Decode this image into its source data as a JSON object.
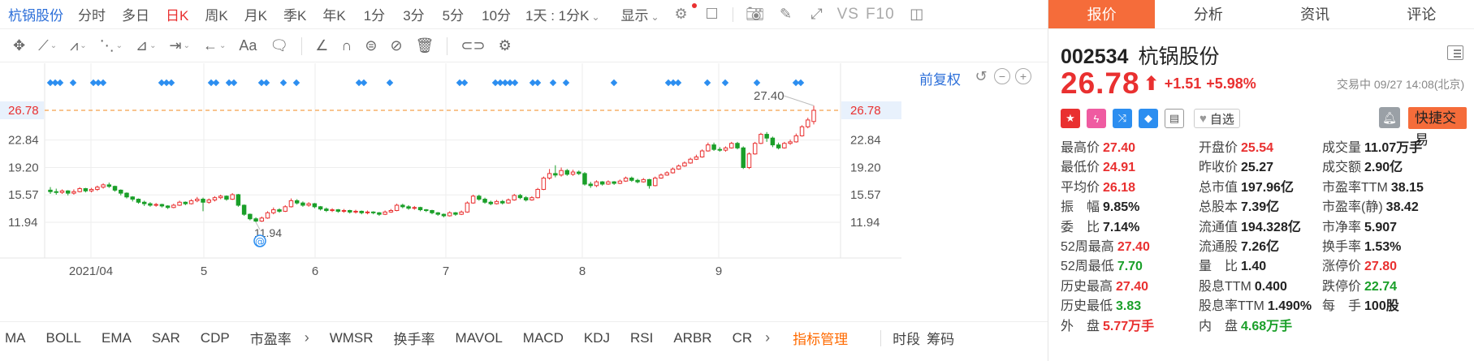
{
  "period_bar": {
    "stock_name": "杭锅股份",
    "periods": [
      "分时",
      "多日",
      "日K",
      "周K",
      "月K",
      "季K",
      "年K",
      "1分",
      "3分",
      "5分",
      "10分"
    ],
    "active": "日K",
    "interval_select": "1天 : 1分K",
    "display_label": "显示",
    "vs_label": "VS",
    "f10_label": "F10"
  },
  "toolbar_icons": [
    "move-icon",
    "line-icon",
    "polyline-icon",
    "wave-icon",
    "ruler-icon",
    "range-icon",
    "arrow-left-icon",
    "text-icon",
    "comment-icon",
    "angle-icon",
    "magnet-icon",
    "eye-lock-icon",
    "eye-off-icon",
    "trash-icon",
    "link-icon",
    "settings-icon"
  ],
  "chart_controls": {
    "adjust_label": "前复权"
  },
  "chart_data": {
    "type": "candlestick",
    "y_ticks": [
      "26.78",
      "22.84",
      "19.20",
      "15.57",
      "11.94"
    ],
    "y_tick_values": [
      26.78,
      22.84,
      19.2,
      15.57,
      11.94
    ],
    "x_ticks": [
      "2021/04",
      "5",
      "6",
      "7",
      "8",
      "9"
    ],
    "current_price": "26.78",
    "annotation_high": "27.40",
    "annotation_low": "11.94",
    "ylim": [
      8.5,
      32.0
    ],
    "candles": [
      [
        16.2,
        16.0,
        16.6,
        15.7
      ],
      [
        16.0,
        15.9,
        16.4,
        15.6
      ],
      [
        15.9,
        16.1,
        16.3,
        15.7
      ],
      [
        16.1,
        15.8,
        16.2,
        15.5
      ],
      [
        15.8,
        16.0,
        16.3,
        15.6
      ],
      [
        16.0,
        16.4,
        16.6,
        15.9
      ],
      [
        16.4,
        16.1,
        16.5,
        15.9
      ],
      [
        16.1,
        16.3,
        16.5,
        15.9
      ],
      [
        16.3,
        16.6,
        16.8,
        16.1
      ],
      [
        16.6,
        16.9,
        17.1,
        16.4
      ],
      [
        16.9,
        16.7,
        17.2,
        16.5
      ],
      [
        16.7,
        16.2,
        16.8,
        16.0
      ],
      [
        16.2,
        15.8,
        16.3,
        15.5
      ],
      [
        15.8,
        15.3,
        15.9,
        15.1
      ],
      [
        15.3,
        15.0,
        15.4,
        14.7
      ],
      [
        15.0,
        14.6,
        15.1,
        14.4
      ],
      [
        14.6,
        14.4,
        14.8,
        14.1
      ],
      [
        14.4,
        14.2,
        14.6,
        14.0
      ],
      [
        14.2,
        14.3,
        14.5,
        14.0
      ],
      [
        14.3,
        14.1,
        14.4,
        13.9
      ],
      [
        14.1,
        13.9,
        14.2,
        13.7
      ],
      [
        13.9,
        14.2,
        14.4,
        13.8
      ],
      [
        14.2,
        14.6,
        14.8,
        14.1
      ],
      [
        14.6,
        14.4,
        14.7,
        14.2
      ],
      [
        14.4,
        14.8,
        15.0,
        14.3
      ],
      [
        14.8,
        15.0,
        15.3,
        14.6
      ],
      [
        15.0,
        14.6,
        15.2,
        13.4
      ],
      [
        14.6,
        14.9,
        15.1,
        14.4
      ],
      [
        14.9,
        15.2,
        15.4,
        14.7
      ],
      [
        15.2,
        15.4,
        15.6,
        15.0
      ],
      [
        15.4,
        15.0,
        15.5,
        14.8
      ],
      [
        15.0,
        15.6,
        15.8,
        14.9
      ],
      [
        15.6,
        14.2,
        15.7,
        14.0
      ],
      [
        14.2,
        13.0,
        14.3,
        12.8
      ],
      [
        13.0,
        12.4,
        13.1,
        12.2
      ],
      [
        12.4,
        12.1,
        12.6,
        11.94
      ],
      [
        12.1,
        12.5,
        12.7,
        12.0
      ],
      [
        12.5,
        13.2,
        13.4,
        12.4
      ],
      [
        13.2,
        13.6,
        13.9,
        13.0
      ],
      [
        13.6,
        13.4,
        13.8,
        13.2
      ],
      [
        13.4,
        14.0,
        14.2,
        13.3
      ],
      [
        14.0,
        14.8,
        15.1,
        13.9
      ],
      [
        14.8,
        14.5,
        15.0,
        14.3
      ],
      [
        14.5,
        14.2,
        14.7,
        14.0
      ],
      [
        14.2,
        14.4,
        14.6,
        14.0
      ],
      [
        14.4,
        14.0,
        14.5,
        13.8
      ],
      [
        14.0,
        13.7,
        14.1,
        13.5
      ],
      [
        13.7,
        13.5,
        13.9,
        13.3
      ],
      [
        13.5,
        13.6,
        13.8,
        13.3
      ],
      [
        13.6,
        13.4,
        13.7,
        13.2
      ],
      [
        13.4,
        13.5,
        13.7,
        13.2
      ],
      [
        13.5,
        13.3,
        13.6,
        13.1
      ],
      [
        13.3,
        13.4,
        13.6,
        13.1
      ],
      [
        13.4,
        13.2,
        13.5,
        13.0
      ],
      [
        13.2,
        13.3,
        13.5,
        13.0
      ],
      [
        13.3,
        13.2,
        13.4,
        13.0
      ],
      [
        13.2,
        13.0,
        13.3,
        12.8
      ],
      [
        13.0,
        13.3,
        13.5,
        12.9
      ],
      [
        13.3,
        13.5,
        13.7,
        13.2
      ],
      [
        13.5,
        14.2,
        14.4,
        13.4
      ],
      [
        14.2,
        14.0,
        14.4,
        13.8
      ],
      [
        14.0,
        13.8,
        14.2,
        13.6
      ],
      [
        13.8,
        13.9,
        14.1,
        13.6
      ],
      [
        13.9,
        13.6,
        14.0,
        13.4
      ],
      [
        13.6,
        13.5,
        13.7,
        13.3
      ],
      [
        13.5,
        13.2,
        13.6,
        13.0
      ],
      [
        13.2,
        13.0,
        13.3,
        12.8
      ],
      [
        13.0,
        12.8,
        13.1,
        12.6
      ],
      [
        12.8,
        13.2,
        13.4,
        12.7
      ],
      [
        13.2,
        13.0,
        13.3,
        12.8
      ],
      [
        13.0,
        13.3,
        13.5,
        12.9
      ],
      [
        13.3,
        14.5,
        14.7,
        13.2
      ],
      [
        14.5,
        15.4,
        15.6,
        14.4
      ],
      [
        15.4,
        15.0,
        15.6,
        14.8
      ],
      [
        15.0,
        14.6,
        15.2,
        14.4
      ],
      [
        14.6,
        14.4,
        14.8,
        14.2
      ],
      [
        14.4,
        14.7,
        14.9,
        14.3
      ],
      [
        14.7,
        14.5,
        14.9,
        14.3
      ],
      [
        14.5,
        14.9,
        15.1,
        14.4
      ],
      [
        14.9,
        15.5,
        15.7,
        14.8
      ],
      [
        15.5,
        15.2,
        15.7,
        15.0
      ],
      [
        15.2,
        14.9,
        15.4,
        14.7
      ],
      [
        14.9,
        15.2,
        15.4,
        14.8
      ],
      [
        15.2,
        16.3,
        16.5,
        15.1
      ],
      [
        16.3,
        17.8,
        18.0,
        16.2
      ],
      [
        17.8,
        18.4,
        19.0,
        17.6
      ],
      [
        18.4,
        18.2,
        19.5,
        17.9
      ],
      [
        18.2,
        18.8,
        19.2,
        18.0
      ],
      [
        18.8,
        18.3,
        19.0,
        18.1
      ],
      [
        18.3,
        18.6,
        18.9,
        18.1
      ],
      [
        18.6,
        18.4,
        18.8,
        18.2
      ],
      [
        18.4,
        17.0,
        18.6,
        16.8
      ],
      [
        17.0,
        16.8,
        17.3,
        16.5
      ],
      [
        16.8,
        17.3,
        17.5,
        16.6
      ],
      [
        17.3,
        17.0,
        17.4,
        16.8
      ],
      [
        17.0,
        17.3,
        17.5,
        16.9
      ],
      [
        17.3,
        17.1,
        17.4,
        16.9
      ],
      [
        17.1,
        17.4,
        17.6,
        17.0
      ],
      [
        17.4,
        17.8,
        18.0,
        17.3
      ],
      [
        17.8,
        17.5,
        18.0,
        17.3
      ],
      [
        17.5,
        17.3,
        17.7,
        17.1
      ],
      [
        17.3,
        17.6,
        17.8,
        17.2
      ],
      [
        17.6,
        16.8,
        17.7,
        16.4
      ],
      [
        16.8,
        17.8,
        18.0,
        16.7
      ],
      [
        17.8,
        18.2,
        18.4,
        17.7
      ],
      [
        18.2,
        18.5,
        18.7,
        18.1
      ],
      [
        18.5,
        19.0,
        19.2,
        18.4
      ],
      [
        19.0,
        19.4,
        19.6,
        18.9
      ],
      [
        19.4,
        19.8,
        20.0,
        19.3
      ],
      [
        19.8,
        20.3,
        20.5,
        19.7
      ],
      [
        20.3,
        20.6,
        20.9,
        20.2
      ],
      [
        20.6,
        21.4,
        21.6,
        20.5
      ],
      [
        21.4,
        22.2,
        22.5,
        21.3
      ],
      [
        22.2,
        21.6,
        22.5,
        21.4
      ],
      [
        21.6,
        21.5,
        21.9,
        21.3
      ],
      [
        21.5,
        21.8,
        22.0,
        21.3
      ],
      [
        21.8,
        22.4,
        22.6,
        21.7
      ],
      [
        22.4,
        21.8,
        22.6,
        21.6
      ],
      [
        21.8,
        19.2,
        22.0,
        19.0
      ],
      [
        19.2,
        21.0,
        21.2,
        19.0
      ],
      [
        21.0,
        22.4,
        22.6,
        20.9
      ],
      [
        22.4,
        23.6,
        23.8,
        22.3
      ],
      [
        23.6,
        23.1,
        23.9,
        22.6
      ],
      [
        23.1,
        22.2,
        23.3,
        21.9
      ],
      [
        22.2,
        21.8,
        22.5,
        21.6
      ],
      [
        21.8,
        22.4,
        22.6,
        21.7
      ],
      [
        22.4,
        22.6,
        22.9,
        22.2
      ],
      [
        22.6,
        23.4,
        23.7,
        22.5
      ],
      [
        23.4,
        24.6,
        24.8,
        23.3
      ],
      [
        24.6,
        25.5,
        25.8,
        24.4
      ],
      [
        25.3,
        26.78,
        27.4,
        24.91
      ]
    ],
    "signal_marker_positions": [
      62,
      68,
      74,
      90,
      115,
      121,
      127,
      199,
      205,
      211,
      260,
      266,
      282,
      288,
      322,
      328,
      349,
      365,
      442,
      448,
      480,
      566,
      572,
      610,
      616,
      622,
      628,
      634,
      656,
      662,
      681,
      697,
      756,
      823,
      829,
      835,
      871,
      893,
      932,
      980,
      986
    ]
  },
  "indicators": {
    "items": [
      "MA",
      "BOLL",
      "EMA",
      "SAR",
      "CDP",
      "市盈率",
      "WMSR",
      "换手率",
      "MAVOL",
      "MACD",
      "KDJ",
      "RSI",
      "ARBR",
      "CR"
    ],
    "manager": "指标管理",
    "extra": [
      "时段",
      "筹码"
    ]
  },
  "right_tabs": [
    "报价",
    "分析",
    "资讯",
    "评论"
  ],
  "active_right_tab": "报价",
  "quote": {
    "code": "002534",
    "name": "杭锅股份",
    "price": "26.78",
    "change": "+1.51",
    "change_pct": "+5.98%",
    "status": "交易中 09/27 14:08(北京)",
    "favorite_label": "自选",
    "trade_label": "快捷交易",
    "rows": [
      [
        {
          "label": "最高价",
          "value": "27.40",
          "color": "red"
        },
        {
          "label": "开盘价",
          "value": "25.54",
          "color": "red"
        },
        {
          "label": "成交量",
          "value": "11.07万手",
          "color": ""
        }
      ],
      [
        {
          "label": "最低价",
          "value": "24.91",
          "color": "red"
        },
        {
          "label": "昨收价",
          "value": "25.27",
          "color": ""
        },
        {
          "label": "成交额",
          "value": "2.90亿",
          "color": ""
        }
      ],
      [
        {
          "label": "平均价",
          "value": "26.18",
          "color": "red"
        },
        {
          "label": "总市值",
          "value": "197.96亿",
          "color": ""
        },
        {
          "label": "市盈率TTM",
          "value": "38.15",
          "color": ""
        }
      ],
      [
        {
          "label": "振　幅",
          "value": "9.85%",
          "color": ""
        },
        {
          "label": "总股本",
          "value": "7.39亿",
          "color": ""
        },
        {
          "label": "市盈率(静)",
          "value": "38.42",
          "color": ""
        }
      ],
      [
        {
          "label": "委　比",
          "value": "7.14%",
          "color": ""
        },
        {
          "label": "流通值",
          "value": "194.328亿",
          "color": ""
        },
        {
          "label": "市净率",
          "value": "5.907",
          "color": ""
        }
      ],
      [
        {
          "label": "52周最高",
          "value": "27.40",
          "color": "red"
        },
        {
          "label": "流通股",
          "value": "7.26亿",
          "color": ""
        },
        {
          "label": "换手率",
          "value": "1.53%",
          "color": ""
        }
      ],
      [
        {
          "label": "52周最低",
          "value": "7.70",
          "color": "green"
        },
        {
          "label": "量　比",
          "value": "1.40",
          "color": ""
        },
        {
          "label": "涨停价",
          "value": "27.80",
          "color": "red"
        }
      ],
      [
        {
          "label": "历史最高",
          "value": "27.40",
          "color": "red"
        },
        {
          "label": "股息TTM",
          "value": "0.400",
          "color": ""
        },
        {
          "label": "跌停价",
          "value": "22.74",
          "color": "green"
        }
      ],
      [
        {
          "label": "历史最低",
          "value": "3.83",
          "color": "green"
        },
        {
          "label": "股息率TTM",
          "value": "1.490%",
          "color": ""
        },
        {
          "label": "每　手",
          "value": "100股",
          "color": ""
        }
      ],
      [
        {
          "label": "外　盘",
          "value": "5.77万手",
          "color": "red"
        },
        {
          "label": "内　盘",
          "value": "4.68万手",
          "color": "green"
        },
        {
          "label": "",
          "value": "",
          "color": ""
        }
      ]
    ]
  },
  "colors": {
    "up": "#e93030",
    "down": "#1a9f29",
    "accent": "#f56c3a",
    "link": "#2c6fd9",
    "signal": "#2c8ef0"
  }
}
